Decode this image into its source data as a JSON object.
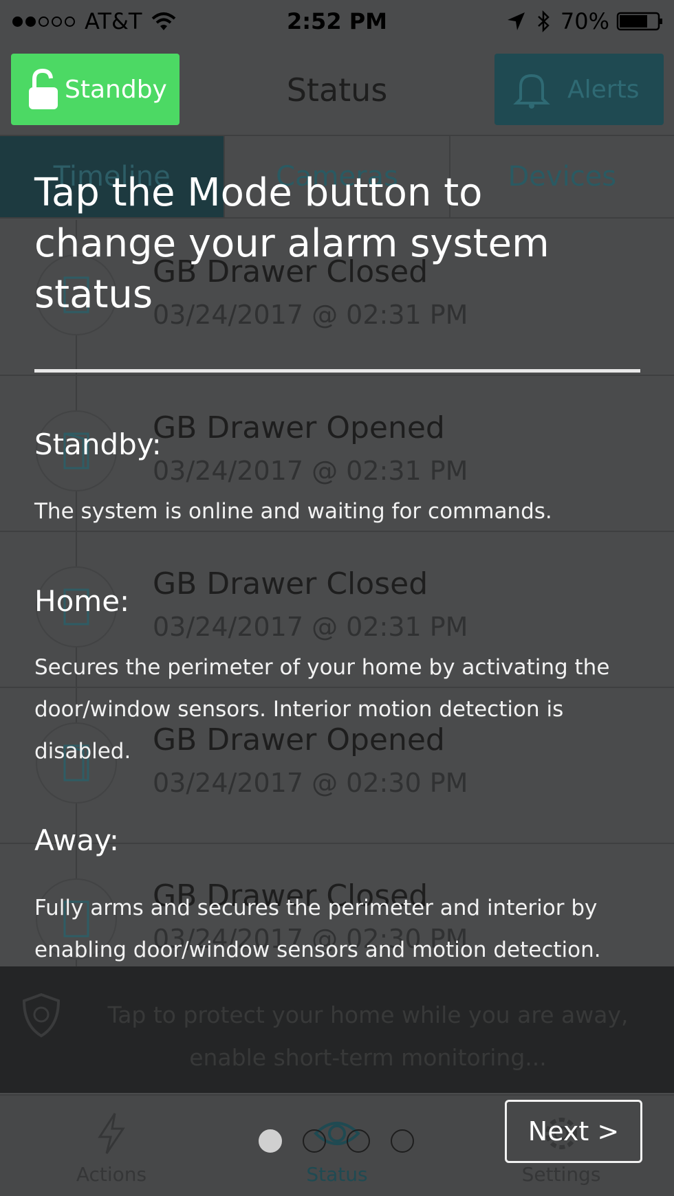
{
  "status_bar": {
    "carrier": "AT&T",
    "time": "2:52 PM",
    "battery": "70%"
  },
  "navbar": {
    "mode_button": "Standby",
    "title": "Status",
    "alerts_button": "Alerts"
  },
  "tabs": [
    {
      "label": "Timeline",
      "active": true
    },
    {
      "label": "Cameras",
      "active": false
    },
    {
      "label": "Devices",
      "active": false
    }
  ],
  "timeline": [
    {
      "title": "GB Drawer Closed",
      "date": "03/24/2017 @ 02:31 PM",
      "icon": "door-closed-icon"
    },
    {
      "title": "GB Drawer Opened",
      "date": "03/24/2017 @ 02:31 PM",
      "icon": "door-open-icon"
    },
    {
      "title": "GB Drawer Closed",
      "date": "03/24/2017 @ 02:31 PM",
      "icon": "door-closed-icon"
    },
    {
      "title": "GB Drawer Opened",
      "date": "03/24/2017 @ 02:30 PM",
      "icon": "door-open-icon"
    },
    {
      "title": "GB Drawer Closed",
      "date": "03/24/2017 @ 02:30 PM",
      "icon": "door-closed-icon"
    }
  ],
  "promo": {
    "text": "Tap to protect your home while you are away, enable short-term monitoring..."
  },
  "tabbar": {
    "actions": "Actions",
    "status": "Status",
    "settings": "Settings"
  },
  "coach": {
    "title": "Tap the Mode button to change your alarm system status",
    "modes": [
      {
        "label": "Standby:",
        "description": "The system is online and waiting for commands."
      },
      {
        "label": "Home:",
        "description": "Secures the perimeter of your home by activating the door/window sensors. Interior motion detection is disabled."
      },
      {
        "label": "Away:",
        "description": "Fully arms and secures the perimeter and interior by enabling door/window sensors and motion detection."
      }
    ],
    "page_count": 4,
    "current_page": 1,
    "next_label": "Next >"
  },
  "colors": {
    "standby_green": "#4cd964",
    "accent_teal": "#1f4a52",
    "overlay_background": "#4a4b4c"
  }
}
